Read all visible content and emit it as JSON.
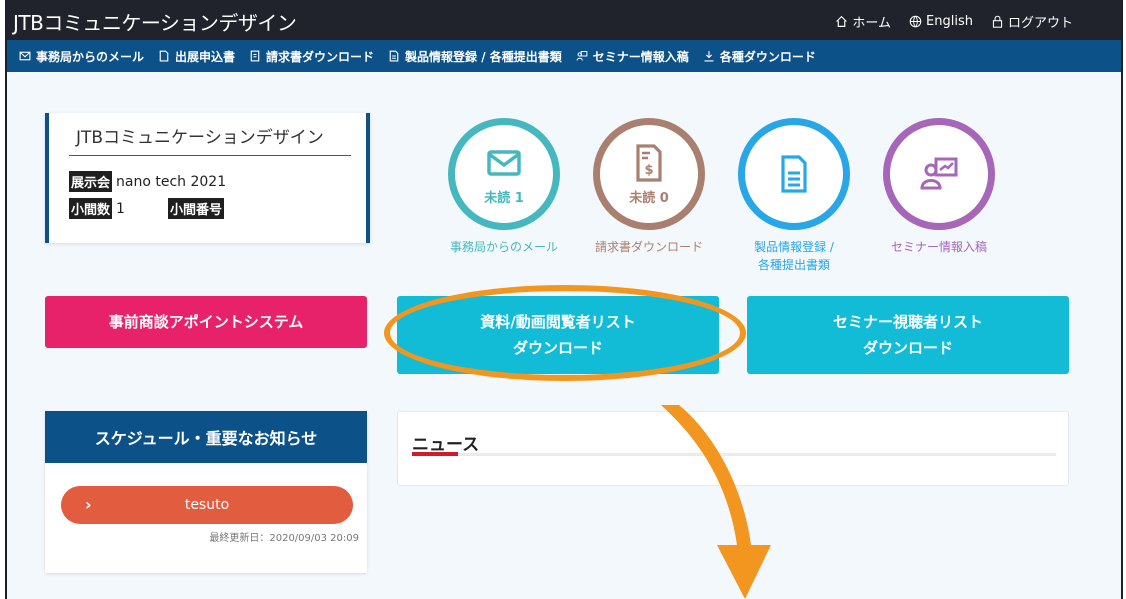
{
  "header": {
    "brand": "JTBコミュニケーションデザイン",
    "nav": [
      {
        "label": "ホーム",
        "icon": "home-icon"
      },
      {
        "label": "English",
        "icon": "globe-icon"
      },
      {
        "label": "ログアウト",
        "icon": "lock-icon"
      }
    ]
  },
  "subnav": [
    {
      "label": "事務局からのメール",
      "icon": "mail-icon"
    },
    {
      "label": "出展申込書",
      "icon": "document-icon"
    },
    {
      "label": "請求書ダウンロード",
      "icon": "invoice-icon"
    },
    {
      "label": "製品情報登録 / 各種提出書類",
      "icon": "file-icon"
    },
    {
      "label": "セミナー情報入稿",
      "icon": "presentation-icon"
    },
    {
      "label": "各種ダウンロード",
      "icon": "download-icon"
    }
  ],
  "info_card": {
    "company": "JTBコミュニケーションデザイン",
    "exhibition_label": "展示会",
    "exhibition_value": "nano tech 2021",
    "booth_count_label": "小間数",
    "booth_count_value": "1",
    "booth_number_label": "小間番号",
    "booth_number_value": ""
  },
  "tiles": [
    {
      "label": "事務局からのメール",
      "badge": "未読 1",
      "color": "#45b8bf",
      "icon": "envelope-icon"
    },
    {
      "label": "請求書ダウンロード",
      "badge": "未読 0",
      "color": "#a98070",
      "icon": "invoice-icon"
    },
    {
      "label_line1": "製品情報登録 /",
      "label_line2": "各種提出書類",
      "color": "#28a6e6",
      "icon": "document-icon"
    },
    {
      "label": "セミナー情報入稿",
      "color": "#a667b8",
      "icon": "presentation-icon"
    }
  ],
  "buttons": {
    "appointment": "事前商談アポイントシステム",
    "viewer_list_line1": "資料/動画閲覧者リスト",
    "viewer_list_line2": "ダウンロード",
    "seminar_list_line1": "セミナー視聴者リスト",
    "seminar_list_line2": "ダウンロード"
  },
  "schedule": {
    "title": "スケジュール・重要なお知らせ",
    "item": "tesuto",
    "updated": "最終更新日：2020/09/03 20:09"
  },
  "news": {
    "title": "ニュース"
  },
  "colors": {
    "topbar": "#20232c",
    "subbar": "#0d5189",
    "pink": "#e8226a",
    "cyan": "#12bcd6",
    "orange_annotation": "#f29620"
  }
}
